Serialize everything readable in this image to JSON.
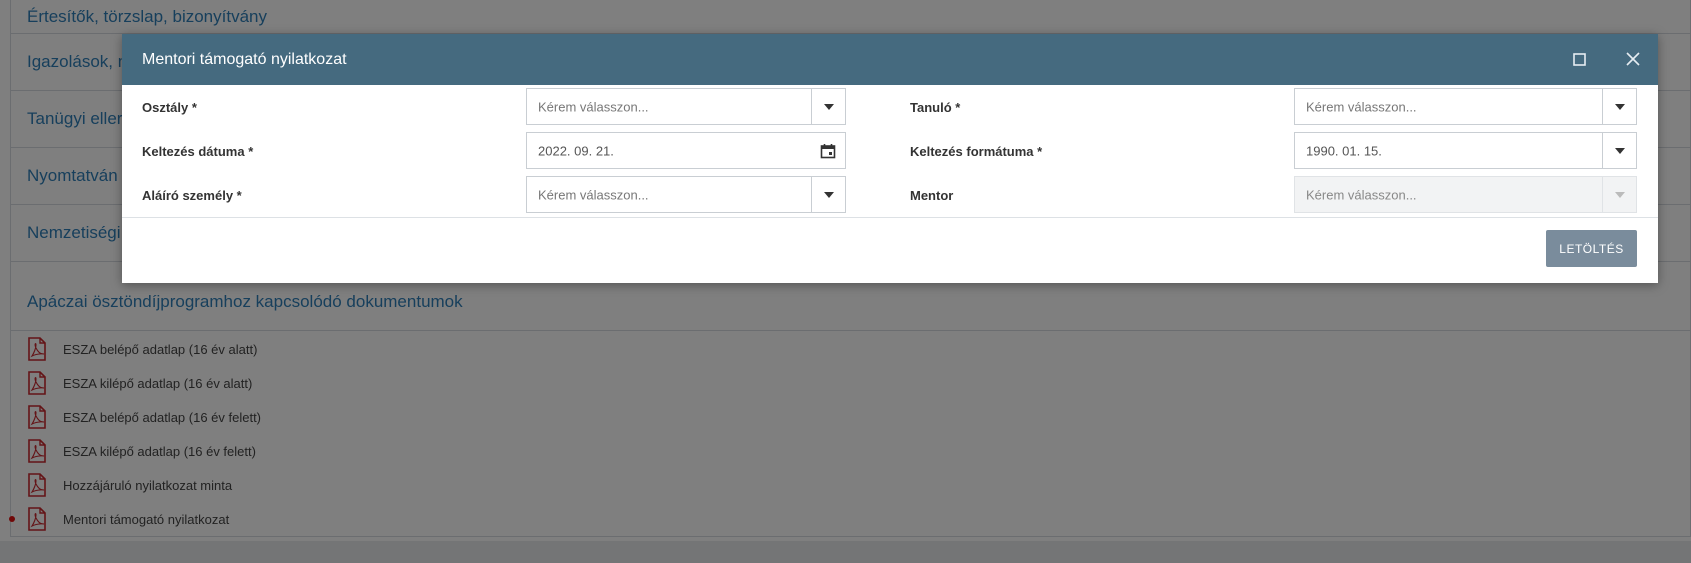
{
  "background": {
    "sections": [
      {
        "title": "Értesítők, törzslap, bizonyítvány"
      },
      {
        "title": "Igazolások, n"
      },
      {
        "title": "Tanügyi eller"
      },
      {
        "title": "Nyomtatván"
      },
      {
        "title": "Nemzetiségi"
      },
      {
        "title": "Apáczai ösztöndíjprogramhoz kapcsolódó dokumentumok"
      }
    ],
    "documents": [
      {
        "label": "ESZA belépő adatlap (16 év alatt)",
        "icon": "pdf-icon"
      },
      {
        "label": "ESZA kilépő adatlap (16 év alatt)",
        "icon": "pdf-icon"
      },
      {
        "label": "ESZA belépő adatlap (16 év felett)",
        "icon": "pdf-icon"
      },
      {
        "label": "ESZA kilépő adatlap (16 év felett)",
        "icon": "pdf-icon"
      },
      {
        "label": "Hozzájáruló nyilatkozat minta",
        "icon": "pdf-icon"
      },
      {
        "label": "Mentori támogató nyilatkozat",
        "icon": "pdf-icon"
      }
    ]
  },
  "modal": {
    "title": "Mentori támogató nyilatkozat",
    "icons": {
      "maximize": "maximize-icon",
      "close": "close-icon"
    },
    "fields": {
      "osztaly": {
        "label": "Osztály *",
        "placeholder": "Kérem válasszon..."
      },
      "tanulo": {
        "label": "Tanuló *",
        "placeholder": "Kérem válasszon..."
      },
      "keltezes_datuma": {
        "label": "Keltezés dátuma *",
        "value": "2022. 09. 21."
      },
      "keltezes_formatuma": {
        "label": "Keltezés formátuma *",
        "value": "1990. 01. 15."
      },
      "alairo": {
        "label": "Aláíró személy *",
        "placeholder": "Kérem válasszon..."
      },
      "mentor": {
        "label": "Mentor",
        "placeholder": "Kérem válasszon..."
      }
    },
    "download_label": "LETÖLTÉS"
  },
  "colors": {
    "header": "#456a7f",
    "link": "#2e7fb8",
    "button": "#7a8c9c",
    "pdf": "#c8282e"
  }
}
